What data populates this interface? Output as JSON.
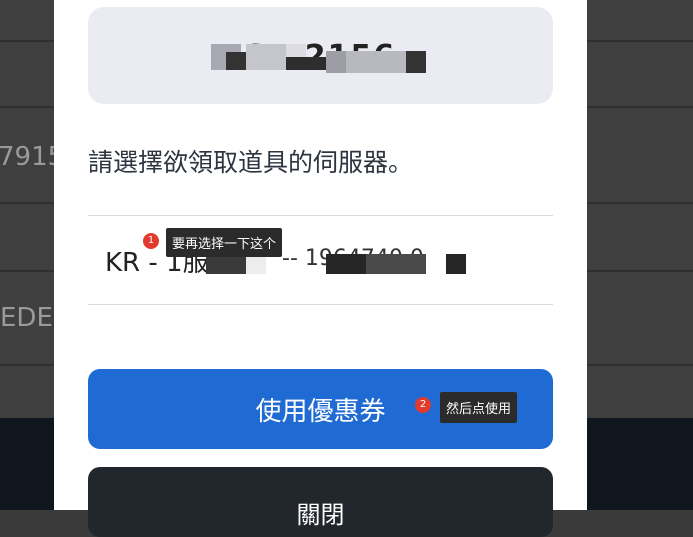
{
  "background": {
    "row_texts": [
      "7915",
      "EDE"
    ]
  },
  "modal": {
    "code_partial": "S    P2156",
    "prompt": "請選擇欲領取道具的伺服器。",
    "server_label": "KR - 1服",
    "server_partial": "--    1964740 0",
    "use_button_label": "使用優惠券",
    "close_button_label": "關閉"
  },
  "annotations": {
    "one": {
      "number": "1",
      "text": "要再选择一下这个"
    },
    "two": {
      "number": "2",
      "text": "然后点使用"
    }
  },
  "colors": {
    "primary_button": "#1f6bd3",
    "close_button": "#22272e",
    "badge": "#e23b2e"
  }
}
